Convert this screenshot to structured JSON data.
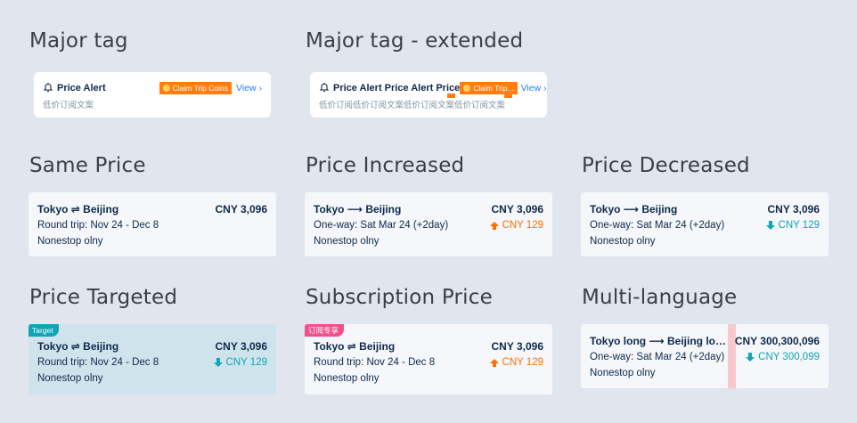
{
  "sections": {
    "major_tag": "Major tag",
    "major_tag_extended": "Major tag - extended",
    "same_price": "Same Price",
    "price_increased": "Price Increased",
    "price_decreased": "Price Decreased",
    "price_targeted": "Price Targeted",
    "subscription_price": "Subscription Price",
    "multi_language": "Multi-language"
  },
  "major_tag_card": {
    "title": "Price Alert",
    "badge": "Claim Trip Coins",
    "view": "View",
    "desc": "低价订阅文案"
  },
  "major_tag_extended_card": {
    "title": "Price Alert Price Alert Price",
    "badge": "Claim Trip...",
    "view": "View",
    "desc": "低价订阅低价订阅文案低价订阅文案低价订阅文案"
  },
  "same_price_card": {
    "route": "Tokyo ⇌ Beijing",
    "price": "CNY 3,096",
    "trip": "Round trip: Nov 24 - Dec 8",
    "stop": "Nonestop olny"
  },
  "increased_card": {
    "route": "Tokyo ⟶ Beijing",
    "price": "CNY 3,096",
    "trip": "One-way: Sat Mar 24 (+2day)",
    "diff": "CNY 129",
    "stop": "Nonestop olny"
  },
  "decreased_card": {
    "route": "Tokyo ⟶ Beijing",
    "price": "CNY 3,096",
    "trip": "One-way: Sat Mar 24 (+2day)",
    "diff": "CNY 129",
    "stop": "Nonestop olny"
  },
  "targeted_card": {
    "tag": "Target",
    "route": "Tokyo ⇌ Beijing",
    "price": "CNY 3,096",
    "trip": "Round trip: Nov 24 - Dec 8",
    "diff": "CNY 129",
    "stop": "Nonestop olny"
  },
  "subscription_card": {
    "tag": "订阅专享",
    "route": "Tokyo ⇌ Beijing",
    "price": "CNY 3,096",
    "trip": "Round trip: Nov 24 - Dec 8",
    "diff": "CNY 129",
    "stop": "Nonestop olny"
  },
  "multi_card": {
    "route": "Tokyo long ⟶ Beijing long ...",
    "price": "CNY 300,300,096",
    "trip": "One-way: Sat Mar 24 (+2day)",
    "diff": "CNY 300,099",
    "stop": "Nonestop olny"
  },
  "colors": {
    "background": "#e1e5ee",
    "increase": "#ff6f00",
    "decrease": "#0ea5b5",
    "link": "#287dfa",
    "target_tag": "#0ea5b5",
    "subscription_tag": "#f2508a"
  },
  "icons": [
    "bell-alert-icon",
    "coin-icon",
    "chevron-right-icon",
    "arrow-up-icon",
    "arrow-down-icon"
  ]
}
